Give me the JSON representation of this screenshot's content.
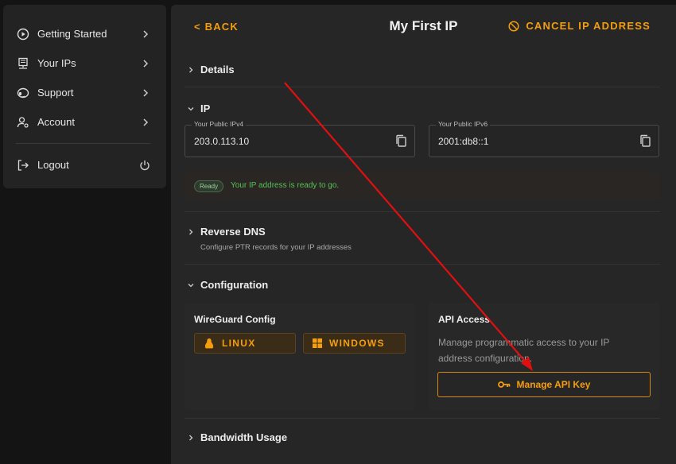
{
  "sidebar": {
    "items": [
      {
        "label": "Getting Started",
        "icon": "play-circle-icon"
      },
      {
        "label": "Your IPs",
        "icon": "server-icon"
      },
      {
        "label": "Support",
        "icon": "headset-icon"
      },
      {
        "label": "Account",
        "icon": "user-gear-icon"
      }
    ],
    "logout": {
      "label": "Logout",
      "icon": "logout-icon"
    }
  },
  "header": {
    "back_label": "< BACK",
    "title": "My First IP",
    "cancel_label": "CANCEL IP ADDRESS"
  },
  "sections": {
    "details": {
      "title": "Details"
    },
    "ip": {
      "title": "IP",
      "ipv4": {
        "label": "Your Public IPv4",
        "value": "203.0.113.10"
      },
      "ipv6": {
        "label": "Your Public IPv6",
        "value": "2001:db8::1"
      },
      "status_badge": "Ready",
      "status_text": "Your IP address is ready to go."
    },
    "reverse_dns": {
      "title": "Reverse DNS",
      "subtitle": "Configure PTR records for your IP addresses"
    },
    "configuration": {
      "title": "Configuration",
      "wireguard": {
        "title": "WireGuard Config",
        "linux_label": "LINUX",
        "windows_label": "WINDOWS"
      },
      "api": {
        "title": "API Access",
        "description": "Manage programmatic access to your IP address configuration.",
        "button_label": "Manage API Key"
      }
    },
    "bandwidth": {
      "title": "Bandwidth Usage"
    }
  },
  "colors": {
    "accent": "#f59e0b",
    "success": "#58c058",
    "annotation_arrow": "#e01010"
  }
}
